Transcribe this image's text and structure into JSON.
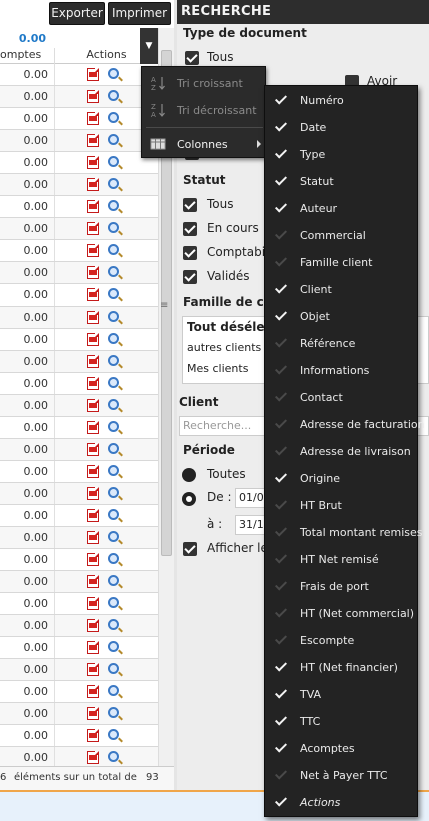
{
  "toolbar": {
    "export_label": "Exporter",
    "print_label": "Imprimer"
  },
  "grid": {
    "total_value": "0.00",
    "col_acomptes": "omptes",
    "col_actions": "Actions",
    "row_amount": "0.00",
    "row_count": 32,
    "footer": {
      "count": "6",
      "text": "éléments sur un total de",
      "total": "93"
    }
  },
  "panel": {
    "title": "RECHERCHE",
    "type_doc": {
      "heading": "Type de document",
      "tous": "Tous",
      "avoir": "Avoir"
    },
    "statut": {
      "heading": "Statut",
      "tous": "Tous",
      "en_cours": "En cours",
      "comptab": "Comptabil",
      "valides": "Validés"
    },
    "famille": {
      "heading": "Famille de cl",
      "tout": "Tout désélec",
      "autres": "autres clients",
      "mes": "Mes clients"
    },
    "client": {
      "heading": "Client",
      "placeholder": "Recherche..."
    },
    "periode": {
      "heading": "Période",
      "toutes": "Toutes",
      "de": "De :",
      "a": "à :",
      "date_from": "01/0",
      "date_to": "31/1"
    },
    "afficher": "Afficher le"
  },
  "sort_menu": {
    "asc": "Tri croissant",
    "desc": "Tri décroissant",
    "columns": "Colonnes"
  },
  "columns_menu": [
    {
      "label": "Numéro",
      "checked": true
    },
    {
      "label": "Date",
      "checked": true
    },
    {
      "label": "Type",
      "checked": true
    },
    {
      "label": "Statut",
      "checked": true
    },
    {
      "label": "Auteur",
      "checked": true
    },
    {
      "label": "Commercial",
      "checked": false
    },
    {
      "label": "Famille client",
      "checked": false
    },
    {
      "label": "Client",
      "checked": true
    },
    {
      "label": "Objet",
      "checked": true
    },
    {
      "label": "Référence",
      "checked": false
    },
    {
      "label": "Informations",
      "checked": false
    },
    {
      "label": "Contact",
      "checked": false
    },
    {
      "label": "Adresse de facturation",
      "checked": false
    },
    {
      "label": "Adresse de livraison",
      "checked": false
    },
    {
      "label": "Origine",
      "checked": true
    },
    {
      "label": "HT Brut",
      "checked": false
    },
    {
      "label": "Total montant remises",
      "checked": false
    },
    {
      "label": "HT Net remisé",
      "checked": false
    },
    {
      "label": "Frais de port",
      "checked": false
    },
    {
      "label": "HT (Net commercial)",
      "checked": false
    },
    {
      "label": "Escompte",
      "checked": false
    },
    {
      "label": "HT (Net financier)",
      "checked": true
    },
    {
      "label": "TVA",
      "checked": true
    },
    {
      "label": "TTC",
      "checked": true
    },
    {
      "label": "Acomptes",
      "checked": true
    },
    {
      "label": "Net à Payer TTC",
      "checked": false
    },
    {
      "label": "Actions",
      "checked": true,
      "italic": true
    }
  ]
}
